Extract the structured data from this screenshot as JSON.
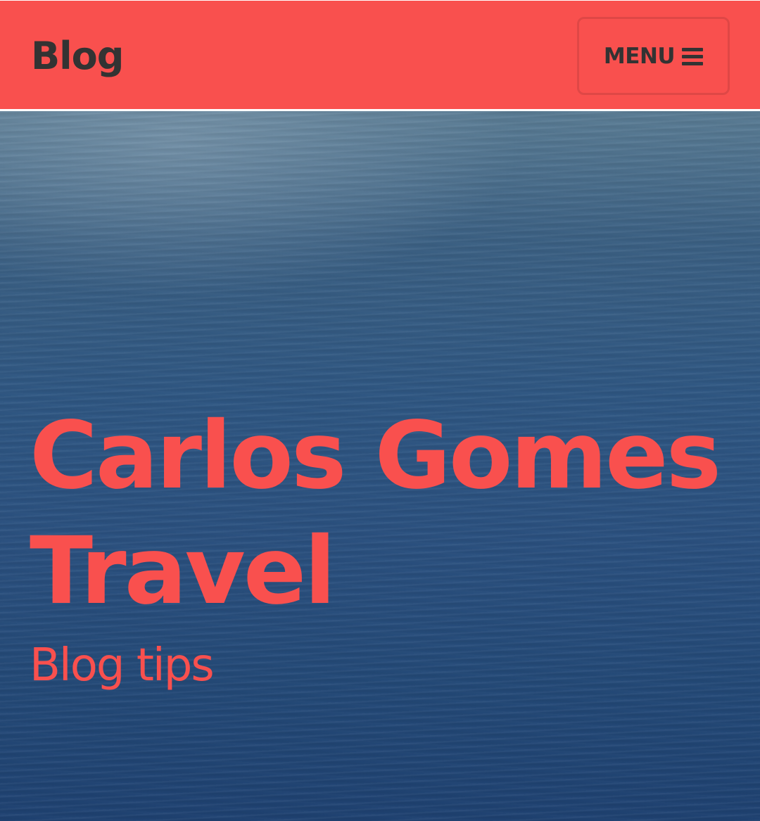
{
  "navbar": {
    "brand": "Blog",
    "menu_label": "MENU",
    "menu_icon": "hamburger-icon",
    "background_color": "#f9504e"
  },
  "hero": {
    "title": "Carlos Gomes Travel",
    "subtitle": "Blog tips",
    "accent_color": "#f9504e"
  }
}
